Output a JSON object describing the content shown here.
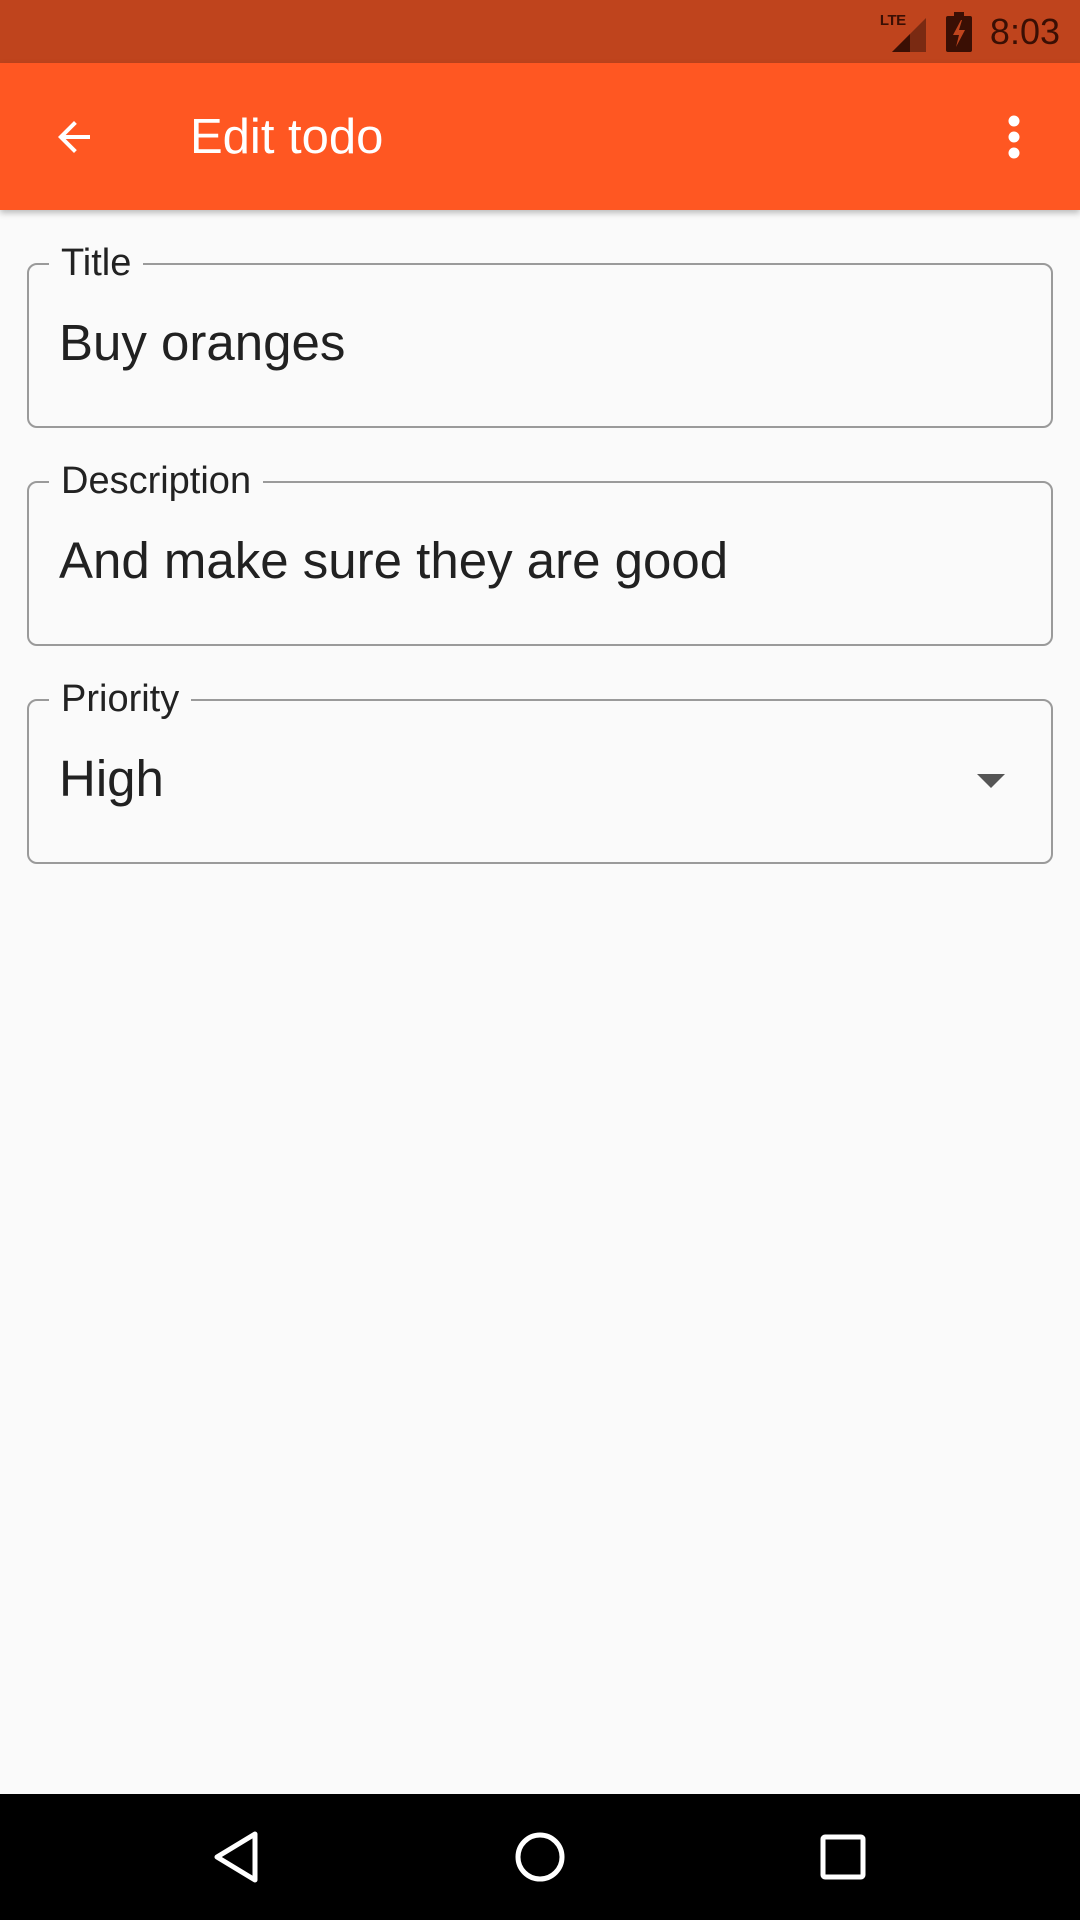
{
  "status_bar": {
    "network_label": "LTE",
    "time": "8:03",
    "icons": [
      "lte-signal-icon",
      "battery-charging-icon"
    ]
  },
  "app_bar": {
    "title": "Edit todo",
    "background_color": "#ff5722",
    "icons": [
      "back-arrow-icon",
      "more-vert-icon"
    ]
  },
  "form": {
    "title_field": {
      "label": "Title",
      "value": "Buy oranges"
    },
    "description_field": {
      "label": "Description",
      "value": "And make sure they are good"
    },
    "priority_field": {
      "label": "Priority",
      "value": "High"
    }
  },
  "nav_bar": {
    "icons": [
      "back-triangle-icon",
      "home-circle-icon",
      "recents-square-icon"
    ]
  }
}
